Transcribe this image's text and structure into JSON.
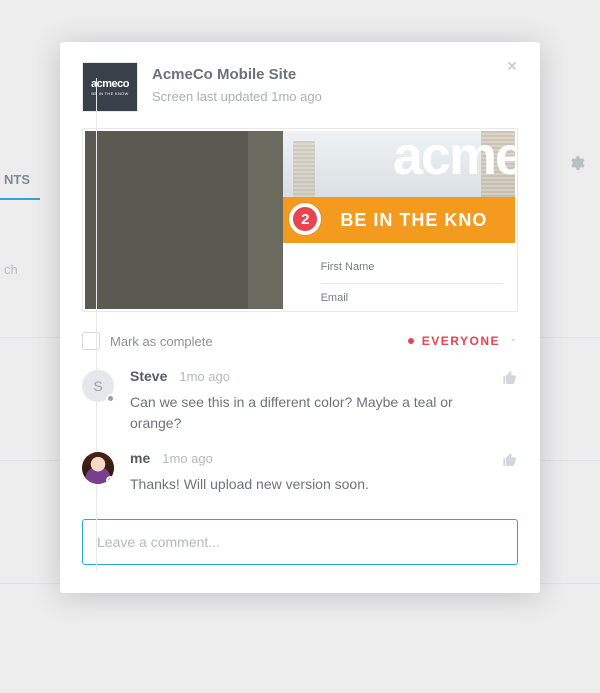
{
  "background": {
    "tab_label": "NTS",
    "search_placeholder": "ch"
  },
  "modal": {
    "title": "AcmeCo Mobile Site",
    "subtitle": "Screen last updated 1mo ago",
    "thumb_logo": "acmeco",
    "thumb_tag": "BE IN THE KNOW",
    "preview": {
      "logo": "acme",
      "banner": "BE IN THE KNO",
      "marker_number": "2",
      "field1": "First Name",
      "field2": "Email"
    },
    "mark_complete_label": "Mark as complete",
    "visibility_label": "EVERYONE"
  },
  "comments": [
    {
      "initial": "S",
      "author": "Steve",
      "time": "1mo ago",
      "text": "Can we see this in a different color? Maybe a teal or orange?",
      "presence": "offline",
      "avatar_type": "initial"
    },
    {
      "initial": "",
      "author": "me",
      "time": "1mo ago",
      "text": "Thanks! Will upload new version soon.",
      "presence": "online",
      "avatar_type": "photo"
    }
  ],
  "input": {
    "placeholder": "Leave a comment..."
  }
}
